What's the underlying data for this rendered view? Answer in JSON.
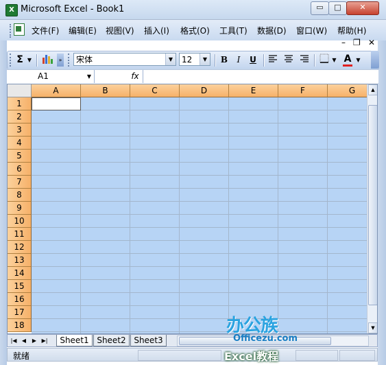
{
  "window": {
    "title": "Microsoft Excel - Book1",
    "app_icon": "excel-icon",
    "controls": {
      "minimize": "▭",
      "maximize": "□",
      "close": "✕"
    }
  },
  "menubar": {
    "items": [
      "文件(F)",
      "编辑(E)",
      "视图(V)",
      "插入(I)",
      "格式(O)",
      "工具(T)",
      "数据(D)",
      "窗口(W)",
      "帮助(H)"
    ],
    "doc_controls": {
      "minimize": "–",
      "restore": "❐",
      "close": "✕"
    }
  },
  "toolbar": {
    "autosum": "Σ",
    "font_name": "宋体",
    "font_size": "12",
    "bold": "B",
    "italic": "I",
    "underline": "U"
  },
  "formula_bar": {
    "name_box": "A1",
    "fx": "fx",
    "value": ""
  },
  "grid": {
    "columns": [
      "A",
      "B",
      "C",
      "D",
      "E",
      "F",
      "G"
    ],
    "rows": [
      "1",
      "2",
      "3",
      "4",
      "5",
      "6",
      "7",
      "8",
      "9",
      "10",
      "11",
      "12",
      "13",
      "14",
      "15",
      "16",
      "17",
      "18"
    ],
    "active_cell": "A1",
    "selection_color": "#b7d4f5",
    "header_color": "#f8bd7c"
  },
  "sheet_tabs": {
    "nav": [
      "|◀",
      "◀",
      "▶",
      "▶|"
    ],
    "tabs": [
      "Sheet1",
      "Sheet2",
      "Sheet3"
    ],
    "active": "Sheet1"
  },
  "status": {
    "text": "就绪"
  },
  "watermark": {
    "brand": "办公族",
    "site": "Officezu.com",
    "tagline": "Excel教程"
  }
}
